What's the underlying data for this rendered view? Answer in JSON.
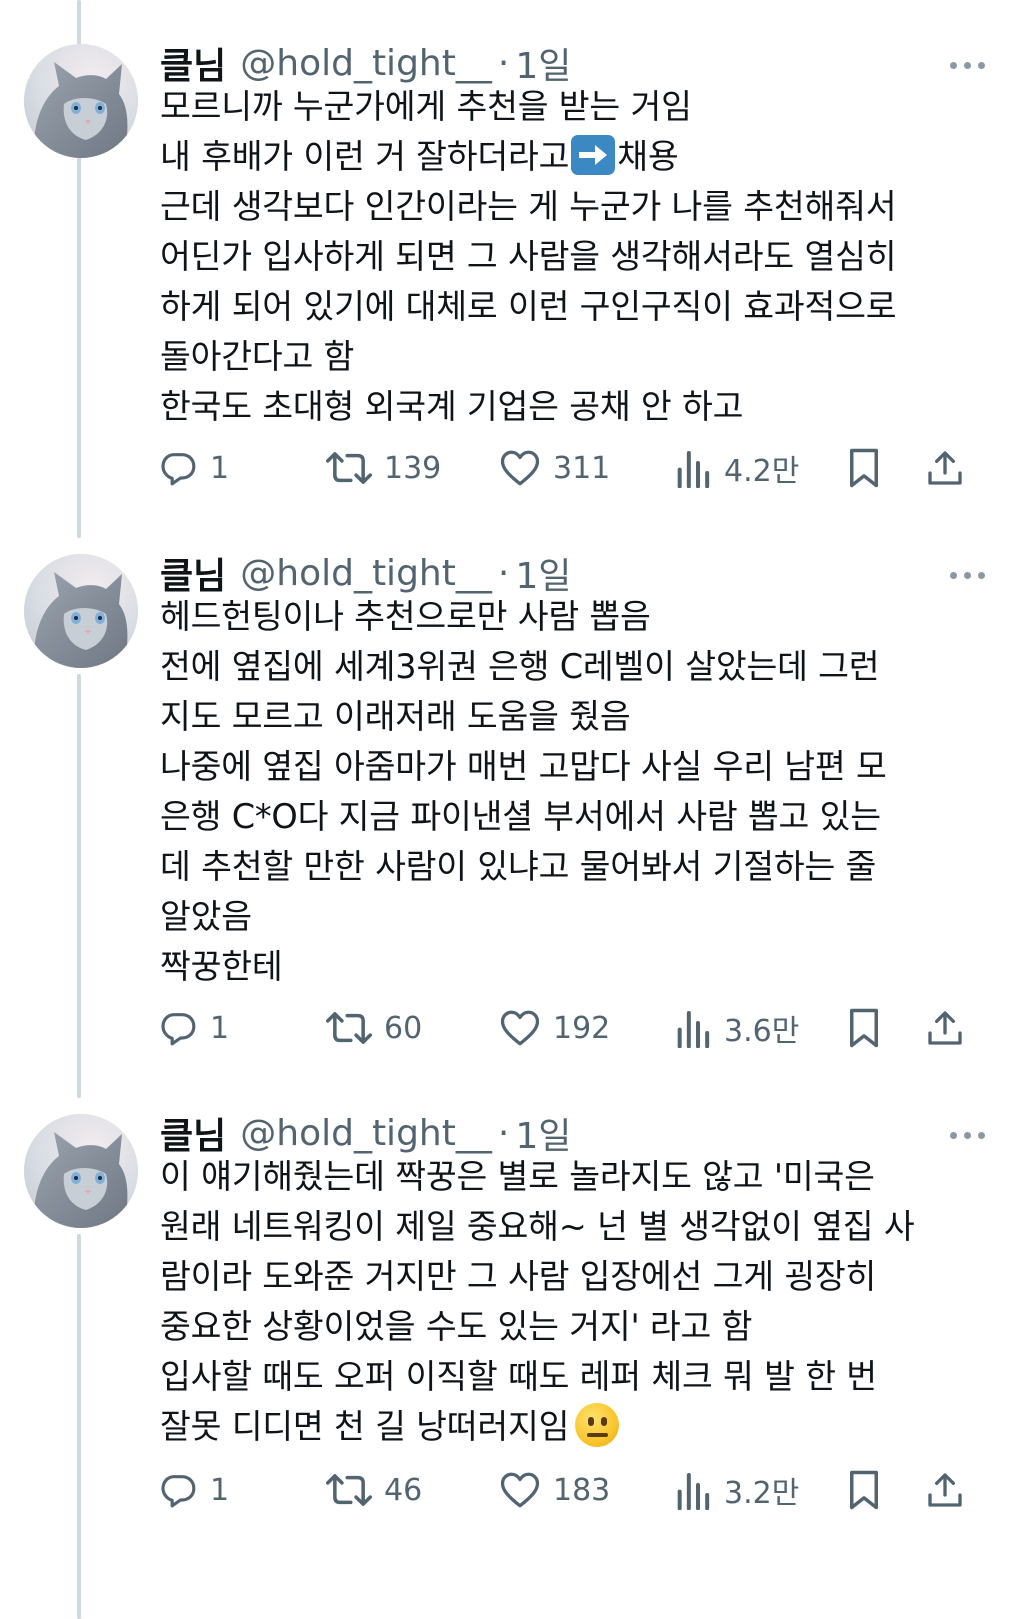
{
  "tweets": [
    {
      "name": "클님",
      "handle": "@hold_tight__",
      "separator": "·",
      "time": "1일",
      "lines": [
        "모르니까 누군가에게 추천을 받는 거임",
        "내 후배가 이런 거 잘하더라고",
        "근데 생각보다 인간이라는 게 누군가 나를 추천해줘서",
        "어딘가 입사하게 되면 그 사람을 생각해서라도 열심히",
        "하게 되어 있기에 대체로 이런 구인구직이 효과적으로",
        "돌아간다고 함",
        "한국도 초대형 외국계 기업은 공채 안 하고"
      ],
      "line2_after_emoji": "채용",
      "replies": "1",
      "retweets": "139",
      "likes": "311",
      "views": "4.2만"
    },
    {
      "name": "클님",
      "handle": "@hold_tight__",
      "separator": "·",
      "time": "1일",
      "lines": [
        "헤드헌팅이나 추천으로만 사람 뽑음",
        "전에 옆집에 세계3위권 은행 C레벨이 살았는데 그런",
        "지도 모르고 이래저래 도움을 줬음",
        "나중에 옆집 아줌마가 매번 고맙다 사실 우리 남편 모",
        "은행 C*O다 지금 파이낸셜 부서에서 사람 뽑고 있는",
        "데 추천할 만한 사람이 있냐고 물어봐서 기절하는 줄",
        "알았음",
        "짝꿍한테"
      ],
      "replies": "1",
      "retweets": "60",
      "likes": "192",
      "views": "3.6만"
    },
    {
      "name": "클님",
      "handle": "@hold_tight__",
      "separator": "·",
      "time": "1일",
      "lines": [
        "이 얘기해줬는데 짝꿍은 별로 놀라지도 않고 '미국은",
        "원래 네트워킹이 제일 중요해~ 넌 별 생각없이 옆집 사",
        "람이라 도와준 거지만 그 사람 입장에선 그게 굉장히",
        "중요한 상황이었을 수도 있는 거지' 라고 함",
        "입사할 때도 오퍼 이직할 때도 레퍼 체크 뭐 발 한 번",
        "잘못 디디면 천 길 낭떠러지임"
      ],
      "replies": "1",
      "retweets": "46",
      "likes": "183",
      "views": "3.2만"
    }
  ],
  "icons": {
    "reply": "reply-icon",
    "retweet": "retweet-icon",
    "like": "heart-icon",
    "views": "views-icon",
    "bookmark": "bookmark-icon",
    "share": "share-icon",
    "more": "more-icon",
    "emoji_arrow": "right-arrow-emoji",
    "emoji_face": "neutral-face-emoji"
  },
  "colors": {
    "text": "#0f1419",
    "secondary": "#536471",
    "thread_line": "#cfd9de"
  }
}
